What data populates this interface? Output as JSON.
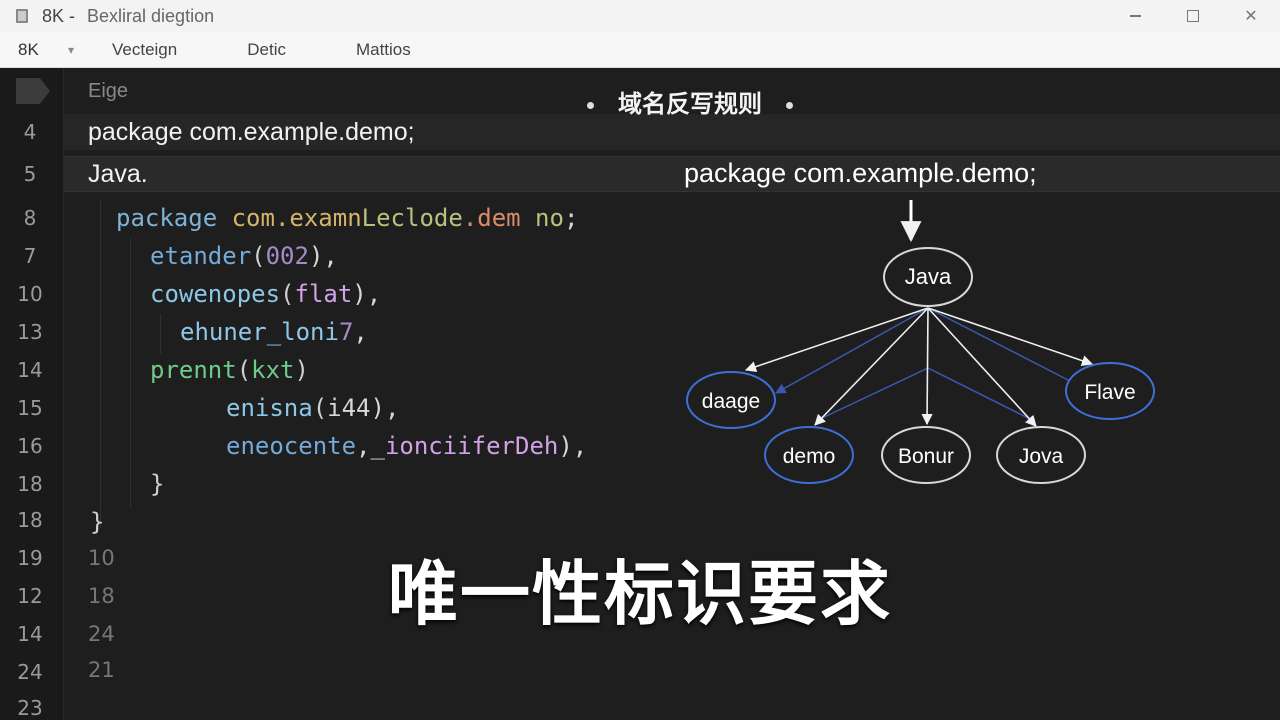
{
  "window": {
    "app_label": "8K -",
    "title": "Bexliral diegtion",
    "min": "–",
    "max": "",
    "close": "✕"
  },
  "menubar": {
    "project": "8K",
    "items": [
      "Vecteign",
      "Detic",
      "Mattios"
    ]
  },
  "editor": {
    "breadcrumb": "Eige",
    "line_numbers": [
      "4",
      "5",
      "8",
      "7",
      "10",
      "13",
      "14",
      "15",
      "16",
      "18",
      "18",
      "19",
      "12",
      "14",
      "24",
      "23"
    ],
    "plain_lines": [
      "package com.example.demo;",
      "Java."
    ],
    "code_lines": [
      {
        "parts": [
          "package",
          " com.examn",
          "Leclode",
          ".dem",
          " no",
          ";"
        ]
      },
      {
        "parts": [
          "etander",
          "(",
          "002",
          "),"
        ]
      },
      {
        "parts": [
          "cowenopes",
          "(",
          "flat",
          "),"
        ]
      },
      {
        "parts": [
          "ehuner_loni",
          "7",
          ","
        ]
      },
      {
        "parts": [
          "prennt",
          "(",
          "kxt",
          ")"
        ]
      },
      {
        "parts": [
          "enisna",
          "(",
          "i44",
          "),"
        ]
      },
      {
        "parts": [
          "eneocente",
          ",_",
          "ionciiferDeh",
          "),"
        ]
      },
      {
        "parts": [
          "}"
        ]
      },
      {
        "parts": [
          "}"
        ]
      },
      {
        "parts": [
          "10"
        ]
      },
      {
        "parts": [
          "18"
        ]
      },
      {
        "parts": [
          "24"
        ]
      },
      {
        "parts": [
          "21"
        ]
      }
    ]
  },
  "diagram": {
    "heading": "域名反写规则",
    "package_label": "package com.example.demo;",
    "nodes": {
      "root": "Java",
      "left": "daage",
      "right": "Flave",
      "b1": "demo",
      "b2": "Bonur",
      "b3": "Jova"
    },
    "colors": {
      "blue_node": "#3d6fd6",
      "white_node": "#d8d8d8"
    }
  },
  "caption": "唯一性标识要求"
}
